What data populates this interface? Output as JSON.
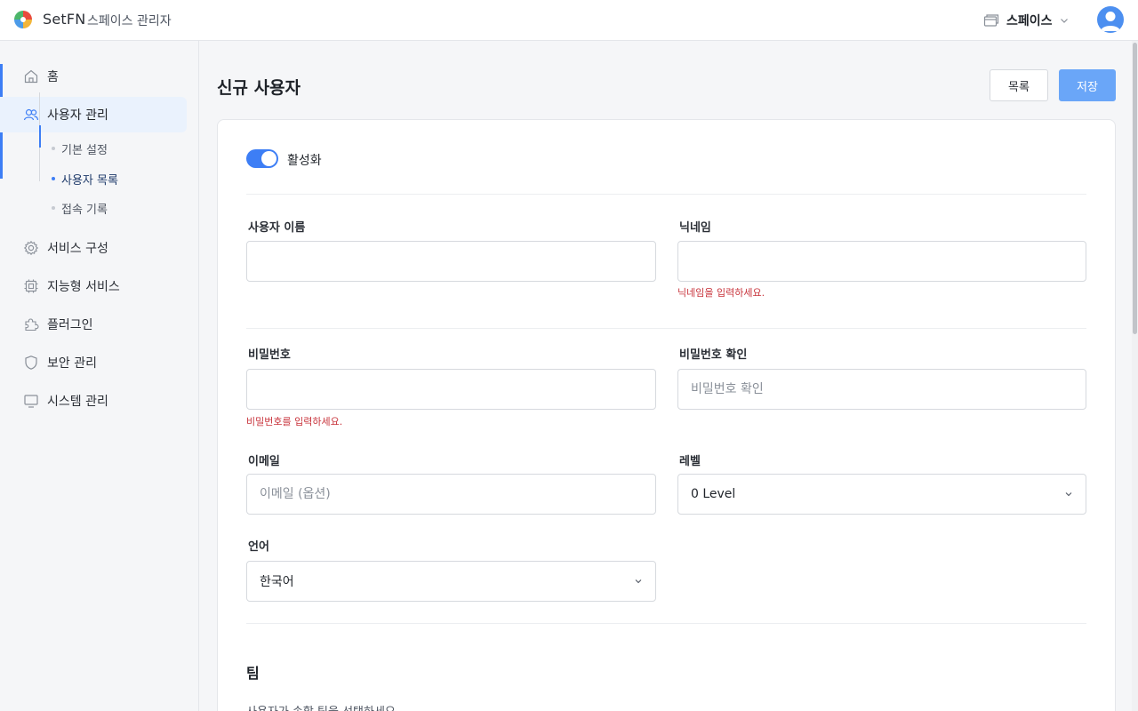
{
  "header": {
    "brand": "SetFN",
    "brand_sub": "스페이스 관리자",
    "space_label": "스페이스"
  },
  "sidebar": {
    "items": [
      {
        "label": "홈",
        "icon": "home-icon"
      },
      {
        "label": "사용자 관리",
        "icon": "users-icon",
        "active": true
      },
      {
        "label": "서비스 구성",
        "icon": "gear-icon"
      },
      {
        "label": "지능형 서비스",
        "icon": "chip-icon"
      },
      {
        "label": "플러그인",
        "icon": "puzzle-icon"
      },
      {
        "label": "보안 관리",
        "icon": "shield-icon"
      },
      {
        "label": "시스템 관리",
        "icon": "monitor-icon"
      }
    ],
    "subitems": [
      {
        "label": "기본 설정"
      },
      {
        "label": "사용자 목록",
        "active": true
      },
      {
        "label": "접속 기록"
      }
    ]
  },
  "page": {
    "title": "신규 사용자",
    "list_button": "목록",
    "save_button": "저장"
  },
  "form": {
    "active_toggle": {
      "label": "활성화",
      "on": true
    },
    "username": {
      "label": "사용자 이름",
      "value": ""
    },
    "nickname": {
      "label": "닉네임",
      "value": "",
      "error": "닉네임을 입력하세요."
    },
    "password": {
      "label": "비밀번호",
      "value": "",
      "error": "비밀번호를 입력하세요."
    },
    "password_confirm": {
      "label": "비밀번호 확인",
      "placeholder": "비밀번호 확인"
    },
    "email": {
      "label": "이메일",
      "placeholder": "이메일 (옵션)"
    },
    "level": {
      "label": "레벨",
      "value": "0 Level"
    },
    "language": {
      "label": "언어",
      "value": "한국어"
    }
  },
  "team": {
    "title": "팀",
    "description": "사용자가 속할 팀을 선택하세요."
  },
  "colors": {
    "accent": "#3d7ef5",
    "save_button": "#6aa6f8",
    "error": "#c8343c"
  }
}
